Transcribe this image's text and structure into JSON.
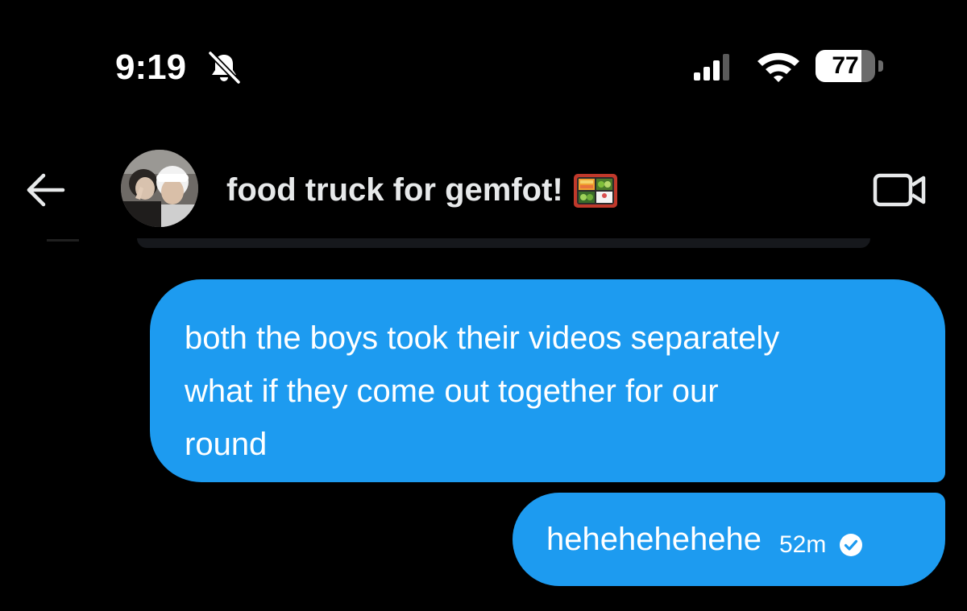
{
  "status_bar": {
    "time": "9:19",
    "battery_level": "77",
    "battery_fraction": 0.77,
    "icons": [
      "bell-slash-icon",
      "cellular-signal-icon",
      "wifi-icon",
      "battery-icon"
    ]
  },
  "header": {
    "back_icon": "arrow-left-icon",
    "avatar_icon": "group-avatar-photo",
    "title": "food truck for gemfot!",
    "title_emoji": "bento-box-icon",
    "video_icon": "video-camera-icon"
  },
  "messages": [
    {
      "text": "both the boys took their videos separately\nwhat if they come out together for our\nround"
    },
    {
      "text": "hehehehehehe",
      "time": "52m",
      "status_icon": "check-circle-icon"
    }
  ],
  "colors": {
    "background": "#000000",
    "bubble": "#1d9bf0",
    "text": "#ffffff"
  }
}
